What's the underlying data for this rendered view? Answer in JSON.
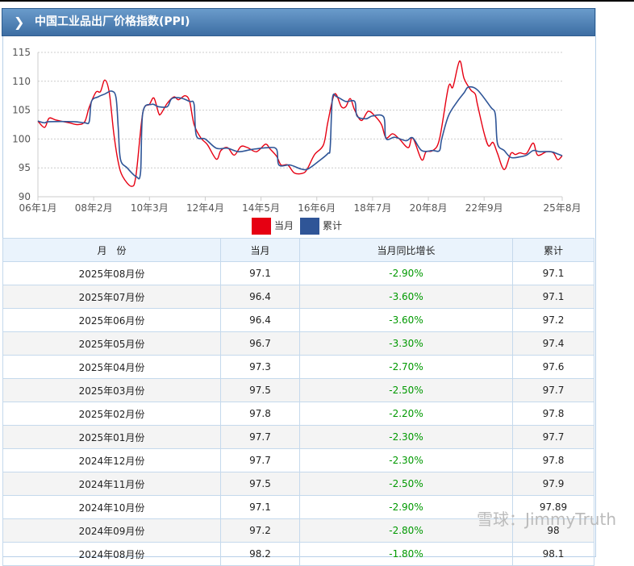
{
  "header": {
    "title": "中国工业品出厂价格指数(PPI)",
    "icon": "chevron-right-icon"
  },
  "chart_data": {
    "type": "line",
    "title": "中国工业品出厂价格指数(PPI)",
    "ylim": [
      90,
      115
    ],
    "yticks": [
      90,
      95,
      100,
      105,
      110,
      115
    ],
    "xlim_months": [
      0,
      235
    ],
    "xticks": [
      {
        "m": 0,
        "label": "06年1月"
      },
      {
        "m": 25,
        "label": "08年2月"
      },
      {
        "m": 50,
        "label": "10年3月"
      },
      {
        "m": 75,
        "label": "12年4月"
      },
      {
        "m": 100,
        "label": "14年5月"
      },
      {
        "m": 125,
        "label": "16年6月"
      },
      {
        "m": 150,
        "label": "18年7月"
      },
      {
        "m": 175,
        "label": "20年8月"
      },
      {
        "m": 200,
        "label": "22年9月"
      },
      {
        "m": 235,
        "label": "25年8月"
      }
    ],
    "grid": true,
    "legend": "bottom",
    "series": [
      {
        "name": "当月",
        "color": "#e60012",
        "points": [
          [
            0,
            103.1
          ],
          [
            3,
            102
          ],
          [
            5,
            103.6
          ],
          [
            8,
            103.3
          ],
          [
            14,
            102.8
          ],
          [
            18,
            102.5
          ],
          [
            21,
            103
          ],
          [
            23,
            105.5
          ],
          [
            26,
            108.1
          ],
          [
            28,
            108.2
          ],
          [
            30,
            110.2
          ],
          [
            32,
            108
          ],
          [
            34,
            101
          ],
          [
            36,
            96
          ],
          [
            38,
            93.5
          ],
          [
            42,
            91.8
          ],
          [
            44,
            93.8
          ],
          [
            47,
            104.5
          ],
          [
            50,
            106
          ],
          [
            52,
            107.1
          ],
          [
            54,
            104.6
          ],
          [
            55,
            104.3
          ],
          [
            58,
            106.2
          ],
          [
            61,
            107.3
          ],
          [
            63,
            106.8
          ],
          [
            66,
            107.5
          ],
          [
            68,
            106.5
          ],
          [
            70,
            102.5
          ],
          [
            73,
            100.2
          ],
          [
            76,
            99
          ],
          [
            80,
            96.5
          ],
          [
            82,
            98
          ],
          [
            85,
            98.5
          ],
          [
            88,
            97.2
          ],
          [
            91,
            98.7
          ],
          [
            94,
            98.5
          ],
          [
            98,
            97.8
          ],
          [
            102,
            99.1
          ],
          [
            104,
            98.3
          ],
          [
            107,
            97
          ],
          [
            109,
            95.5
          ],
          [
            112,
            95.5
          ],
          [
            115,
            94.1
          ],
          [
            119,
            94.1
          ],
          [
            121,
            95
          ],
          [
            124,
            97.3
          ],
          [
            128,
            99
          ],
          [
            130,
            103
          ],
          [
            133,
            107.8
          ],
          [
            136,
            105.6
          ],
          [
            138,
            105.6
          ],
          [
            140,
            107
          ],
          [
            142,
            105
          ],
          [
            145,
            103.2
          ],
          [
            148,
            104.8
          ],
          [
            151,
            104
          ],
          [
            154,
            102.5
          ],
          [
            156,
            100.2
          ],
          [
            159,
            100.9
          ],
          [
            162,
            100
          ],
          [
            166,
            98.5
          ],
          [
            168,
            100.2
          ],
          [
            172,
            96.4
          ],
          [
            174,
            97.8
          ],
          [
            177,
            98
          ],
          [
            180,
            100
          ],
          [
            184,
            109
          ],
          [
            186,
            109
          ],
          [
            189,
            113.5
          ],
          [
            191,
            110.5
          ],
          [
            194,
            108.5
          ],
          [
            196,
            107.8
          ],
          [
            197,
            106
          ],
          [
            200,
            101
          ],
          [
            202,
            98.8
          ],
          [
            204,
            99.4
          ],
          [
            206,
            97.5
          ],
          [
            209,
            94.7
          ],
          [
            212,
            97.5
          ],
          [
            214,
            97.3
          ],
          [
            216,
            97.6
          ],
          [
            219,
            97.5
          ],
          [
            222,
            99.3
          ],
          [
            224,
            97.2
          ],
          [
            228,
            97.8
          ],
          [
            231,
            97.6
          ],
          [
            233,
            96.4
          ],
          [
            235,
            97.1
          ]
        ]
      },
      {
        "name": "累计",
        "color": "#2f5597",
        "points": [
          [
            0,
            103.1
          ],
          [
            3,
            102.8
          ],
          [
            5,
            103
          ],
          [
            16,
            103
          ],
          [
            21,
            102.8
          ],
          [
            23,
            103
          ],
          [
            24,
            106.5
          ],
          [
            27,
            107.3
          ],
          [
            30,
            107.8
          ],
          [
            33,
            108.3
          ],
          [
            35,
            107.2
          ],
          [
            36,
            102
          ],
          [
            37,
            96.5
          ],
          [
            40,
            95
          ],
          [
            44,
            93.5
          ],
          [
            46,
            94.2
          ],
          [
            47,
            104.5
          ],
          [
            51,
            106
          ],
          [
            54,
            105.6
          ],
          [
            58,
            105.6
          ],
          [
            60,
            107
          ],
          [
            64,
            107.1
          ],
          [
            68,
            106.5
          ],
          [
            70,
            106
          ],
          [
            71,
            100.6
          ],
          [
            75,
            100
          ],
          [
            80,
            98.4
          ],
          [
            85,
            98.4
          ],
          [
            90,
            97.8
          ],
          [
            96,
            98.2
          ],
          [
            103,
            98.5
          ],
          [
            107,
            98.2
          ],
          [
            108,
            95.5
          ],
          [
            113,
            95.5
          ],
          [
            118,
            94.8
          ],
          [
            121,
            94.8
          ],
          [
            126,
            96.2
          ],
          [
            130,
            97.5
          ],
          [
            131,
            98.5
          ],
          [
            132,
            107
          ],
          [
            134,
            107.3
          ],
          [
            138,
            106.5
          ],
          [
            142,
            106.5
          ],
          [
            143,
            104
          ],
          [
            147,
            103.5
          ],
          [
            150,
            104
          ],
          [
            155,
            103.8
          ],
          [
            156,
            100.1
          ],
          [
            160,
            100.3
          ],
          [
            165,
            99.7
          ],
          [
            168,
            100.2
          ],
          [
            172,
            98
          ],
          [
            177,
            98
          ],
          [
            180,
            98
          ],
          [
            181,
            100
          ],
          [
            184,
            104
          ],
          [
            188,
            106.5
          ],
          [
            191,
            108
          ],
          [
            193,
            109
          ],
          [
            197,
            108.5
          ],
          [
            203,
            105.5
          ],
          [
            205,
            104.3
          ],
          [
            206,
            99.2
          ],
          [
            209,
            98
          ],
          [
            212,
            96.8
          ],
          [
            216,
            96.9
          ],
          [
            219,
            97.2
          ],
          [
            222,
            98
          ],
          [
            225,
            97.8
          ],
          [
            230,
            97.8
          ],
          [
            233,
            97.4
          ],
          [
            235,
            97.1
          ]
        ]
      }
    ]
  },
  "legend": [
    {
      "label": "当月",
      "color": "#e60012"
    },
    {
      "label": "累计",
      "color": "#2f5597"
    }
  ],
  "table": {
    "columns": [
      "月　份",
      "当月",
      "当月同比增长",
      "累计"
    ],
    "rows": [
      [
        "2025年08月份",
        "97.1",
        "-2.90%",
        "97.1"
      ],
      [
        "2025年07月份",
        "96.4",
        "-3.60%",
        "97.1"
      ],
      [
        "2025年06月份",
        "96.4",
        "-3.60%",
        "97.2"
      ],
      [
        "2025年05月份",
        "96.7",
        "-3.30%",
        "97.4"
      ],
      [
        "2025年04月份",
        "97.3",
        "-2.70%",
        "97.6"
      ],
      [
        "2025年03月份",
        "97.5",
        "-2.50%",
        "97.7"
      ],
      [
        "2025年02月份",
        "97.8",
        "-2.20%",
        "97.8"
      ],
      [
        "2025年01月份",
        "97.7",
        "-2.30%",
        "97.7"
      ],
      [
        "2024年12月份",
        "97.7",
        "-2.30%",
        "97.8"
      ],
      [
        "2024年11月份",
        "97.5",
        "-2.50%",
        "97.9"
      ],
      [
        "2024年10月份",
        "97.1",
        "-2.90%",
        "97.89"
      ],
      [
        "2024年09月份",
        "97.2",
        "-2.80%",
        "98"
      ],
      [
        "2024年08月份",
        "98.2",
        "-1.80%",
        "98.1"
      ]
    ]
  },
  "watermark": "雪球：JimmyTruth"
}
